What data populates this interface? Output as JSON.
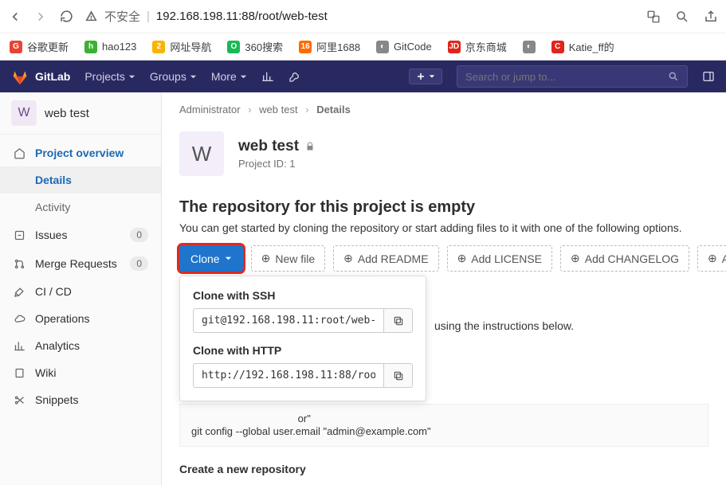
{
  "browser": {
    "unsafe_label": "不安全",
    "url": "192.168.198.11:88/root/web-test"
  },
  "bookmarks": [
    {
      "label": "谷歌更新",
      "color": "#ea4335",
      "glyph": "G"
    },
    {
      "label": "hao123",
      "color": "#3cb034",
      "glyph": "h"
    },
    {
      "label": "网址导航",
      "color": "#f7b500",
      "glyph": "2"
    },
    {
      "label": "360搜索",
      "color": "#19b955",
      "glyph": "O"
    },
    {
      "label": "阿里1688",
      "color": "#ff6a00",
      "glyph": "16"
    },
    {
      "label": "GitCode",
      "color": "#888",
      "glyph": "◐"
    },
    {
      "label": "京东商城",
      "color": "#e1251b",
      "glyph": "JD"
    },
    {
      "label": "",
      "color": "#888",
      "glyph": "◐"
    },
    {
      "label": "Katie_ff的",
      "color": "#e1251b",
      "glyph": "C"
    }
  ],
  "topnav": {
    "brand": "GitLab",
    "projects": "Projects",
    "groups": "Groups",
    "more": "More",
    "search_placeholder": "Search or jump to..."
  },
  "sidebar": {
    "avatar": "W",
    "title": "web test",
    "items": {
      "overview": "Project overview",
      "details": "Details",
      "activity": "Activity",
      "issues": "Issues",
      "issues_count": "0",
      "mrs": "Merge Requests",
      "mrs_count": "0",
      "cicd": "CI / CD",
      "operations": "Operations",
      "analytics": "Analytics",
      "wiki": "Wiki",
      "snippets": "Snippets"
    }
  },
  "crumbs": {
    "owner": "Administrator",
    "project": "web test",
    "page": "Details"
  },
  "project": {
    "avatar": "W",
    "name": "web test",
    "id_label": "Project ID: 1"
  },
  "empty": {
    "title": "The repository for this project is empty",
    "desc": "You can get started by cloning the repository or start adding files to it with one of the following options."
  },
  "actions": {
    "clone": "Clone",
    "new_file": "New file",
    "add_readme": "Add README",
    "add_license": "Add LICENSE",
    "add_changelog": "Add CHANGELOG",
    "add_contributing": "Add CONTRIBU"
  },
  "clone_popup": {
    "ssh_label": "Clone with SSH",
    "ssh_value": "git@192.168.198.11:root/web-",
    "http_label": "Clone with HTTP",
    "http_value": "http://192.168.198.11:88/roo"
  },
  "behind": {
    "instructions_tail": "using the instructions below.",
    "code_line1": "                                     or\"",
    "code_line2": "git config --global user.email \"admin@example.com\"",
    "create_title": "Create a new repository"
  }
}
